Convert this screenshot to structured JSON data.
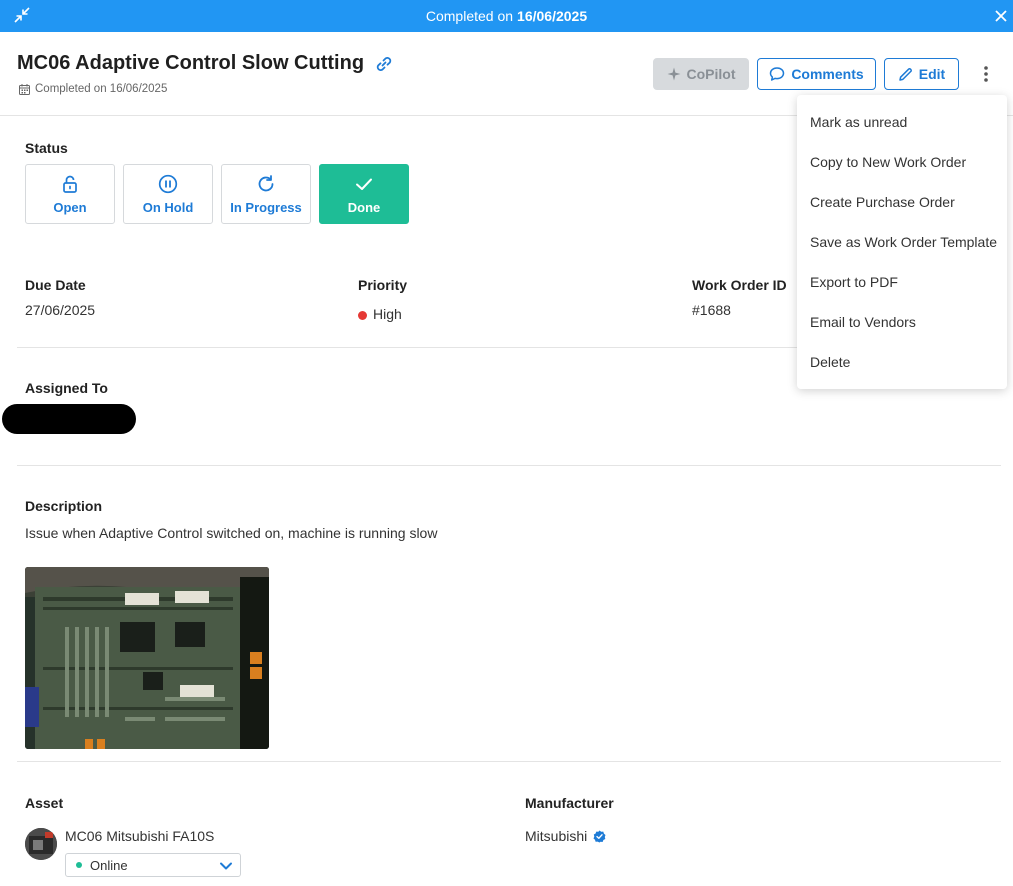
{
  "banner": {
    "prefix": "Completed on",
    "date": "16/06/2025"
  },
  "header": {
    "title": "MC06 Adaptive Control Slow Cutting",
    "subtitle": "Completed on 16/06/2025",
    "copilot_label": "CoPilot",
    "comments_label": "Comments",
    "edit_label": "Edit"
  },
  "status": {
    "label": "Status",
    "options": [
      {
        "label": "Open",
        "icon": "unlock-icon"
      },
      {
        "label": "On Hold",
        "icon": "pause-icon"
      },
      {
        "label": "In Progress",
        "icon": "refresh-icon"
      },
      {
        "label": "Done",
        "icon": "check-icon"
      }
    ],
    "active": "Done",
    "active_color": "#1ebd96"
  },
  "details": {
    "due_date_label": "Due Date",
    "due_date": "27/06/2025",
    "priority_label": "Priority",
    "priority": "High",
    "priority_color": "#e53935",
    "work_order_label": "Work Order ID",
    "work_order_id": "#1688"
  },
  "assigned": {
    "label": "Assigned To"
  },
  "description": {
    "label": "Description",
    "text": "Issue when Adaptive Control switched on, machine is running slow"
  },
  "asset": {
    "label": "Asset",
    "name": "MC06 Mitsubishi FA10S",
    "status": "Online",
    "status_color": "#1ebd96"
  },
  "manufacturer": {
    "label": "Manufacturer",
    "name": "Mitsubishi"
  },
  "menu": {
    "items": [
      "Mark as unread",
      "Copy to New Work Order",
      "Create Purchase Order",
      "Save as Work Order Template",
      "Export to PDF",
      "Email to Vendors",
      "Delete"
    ]
  },
  "colors": {
    "banner": "#2196f3",
    "accent": "#1e7bd6"
  }
}
